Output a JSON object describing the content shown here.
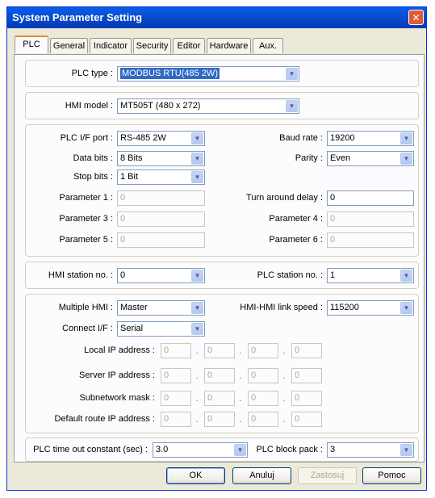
{
  "window": {
    "title": "System Parameter Setting",
    "close_icon": "close-icon"
  },
  "tabs": [
    "PLC",
    "General",
    "Indicator",
    "Security",
    "Editor",
    "Hardware",
    "Aux."
  ],
  "plc_type": {
    "label": "PLC type :",
    "value": "MODBUS RTU(485 2W)"
  },
  "hmi_model": {
    "label": "HMI model :",
    "value": "MT505T (480 x 272)"
  },
  "comm": {
    "plc_if_port": {
      "label": "PLC I/F port :",
      "value": "RS-485 2W"
    },
    "baud_rate": {
      "label": "Baud rate :",
      "value": "19200"
    },
    "data_bits": {
      "label": "Data bits :",
      "value": "8 Bits"
    },
    "parity": {
      "label": "Parity :",
      "value": "Even"
    },
    "stop_bits": {
      "label": "Stop bits :",
      "value": "1 Bit"
    },
    "parameter1": {
      "label": "Parameter 1 :",
      "value": "0"
    },
    "turn_around_delay": {
      "label": "Turn around delay :",
      "value": "0"
    },
    "parameter3": {
      "label": "Parameter 3 :",
      "value": "0"
    },
    "parameter4": {
      "label": "Parameter 4 :",
      "value": "0"
    },
    "parameter5": {
      "label": "Parameter 5 :",
      "value": "0"
    },
    "parameter6": {
      "label": "Parameter 6 :",
      "value": "0"
    }
  },
  "station": {
    "hmi_station": {
      "label": "HMI station no. :",
      "value": "0"
    },
    "plc_station": {
      "label": "PLC station no. :",
      "value": "1"
    }
  },
  "multi": {
    "multiple_hmi": {
      "label": "Multiple HMI :",
      "value": "Master"
    },
    "link_speed": {
      "label": "HMI-HMI link speed :",
      "value": "115200"
    },
    "connect_if": {
      "label": "Connect I/F :",
      "value": "Serial"
    },
    "local_ip": {
      "label": "Local IP address :",
      "octets": [
        "0",
        "0",
        "0",
        "0"
      ]
    },
    "server_ip": {
      "label": "Server IP address :",
      "octets": [
        "0",
        "0",
        "0",
        "0"
      ]
    },
    "subnet": {
      "label": "Subnetwork mask :",
      "octets": [
        "0",
        "0",
        "0",
        "0"
      ]
    },
    "route_ip": {
      "label": "Default route IP address :",
      "octets": [
        "0",
        "0",
        "0",
        "0"
      ]
    },
    "ip_dot": "."
  },
  "bottom": {
    "timeout": {
      "label": "PLC time out constant (sec) :",
      "value": "3.0"
    },
    "block_pack": {
      "label": "PLC block pack :",
      "value": "3"
    }
  },
  "buttons": {
    "ok": "OK",
    "cancel": "Anuluj",
    "apply": "Zastosuj",
    "help": "Pomoc"
  },
  "colors": {
    "title_bar": "#0a5ee8",
    "selection": "#316ac5",
    "tab_highlight": "#e68b2c"
  }
}
